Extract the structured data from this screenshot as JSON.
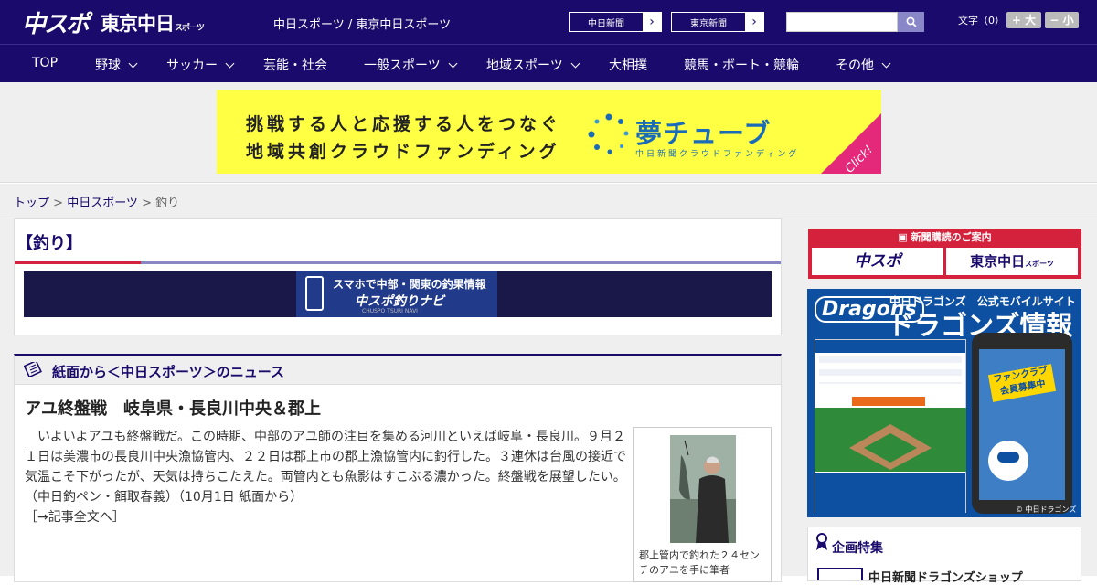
{
  "header": {
    "logo_chuspo": "中スポ",
    "logo_tokyo": "東京中日",
    "logo_tokyo_sub": "スポーツ",
    "site_title": "中日スポーツ / 東京中日スポーツ",
    "link_chunichi": "中日新聞",
    "link_tokyo": "東京新聞",
    "search_placeholder": "",
    "font_label": "文字（0）",
    "font_large": "+ 大",
    "font_small": "− 小"
  },
  "nav": {
    "items": [
      "TOP",
      "野球",
      "サッカー",
      "芸能・社会",
      "一般スポーツ",
      "地域スポーツ",
      "大相撲",
      "競馬・ボート・競輪",
      "その他"
    ]
  },
  "top_banner": {
    "line1": "挑戦する人と応援する人をつなぐ",
    "line2": "地域共創クラウドファンディング",
    "brand": "夢チューブ",
    "sub": "中日新聞クラウドファンディング",
    "click": "Click!"
  },
  "breadcrumb": {
    "home": "トップ",
    "sep1": " > ",
    "section": "中日スポーツ",
    "sep2": " > ",
    "current": "釣り"
  },
  "category": {
    "title": "【釣り】"
  },
  "navi_banner": {
    "line1": "スマホで中部・関東の釣果情報",
    "line2": "中スポ釣りナビ",
    "line3": "CHUSPO TSURI NAVI"
  },
  "news": {
    "heading": "紙面から＜中日スポーツ＞のニュース",
    "title": "アユ終盤戦　岐阜県・長良川中央＆郡上",
    "body": "　いよいよアユも終盤戦だ。この時期、中部のアユ師の注目を集める河川といえば岐阜・長良川。９月２１日は美濃市の長良川中央漁協管内、２２日は郡上市の郡上漁協管内に釣行した。３連休は台風の接近で気温こそ下がったが、天気は持ちこたえた。両管内とも魚影はすこぶる濃かった。終盤戦を展望したい。　（中日釣ペン・餌取春義）（10月1日 紙面から）",
    "more": "［→記事全文へ］",
    "photo_caption": "郡上管内で釣れた２４センチのアユを手に筆者"
  },
  "sidebar": {
    "sub_head": "新聞購読のご案内",
    "sub_chuspo": "中スポ",
    "sub_tokyo": "東京中日",
    "sub_tokyo_small": "スポーツ",
    "dragons_logo": "Dragons",
    "dragons_t1": "中日ドラゴンズ　公式モバイルサイト",
    "dragons_t2": "ドラゴンズ情報",
    "dragons_badge": "ファンクラブ 会員募集中",
    "dragons_copy": "© 中日ドラゴンズ",
    "feature_title": "企画特集",
    "feature_item": "中日新聞ドラゴンズショップ"
  },
  "colors": {
    "navy": "#1a0a6b",
    "accent_red": "#d4223c",
    "banner_yellow": "#ffff44"
  }
}
